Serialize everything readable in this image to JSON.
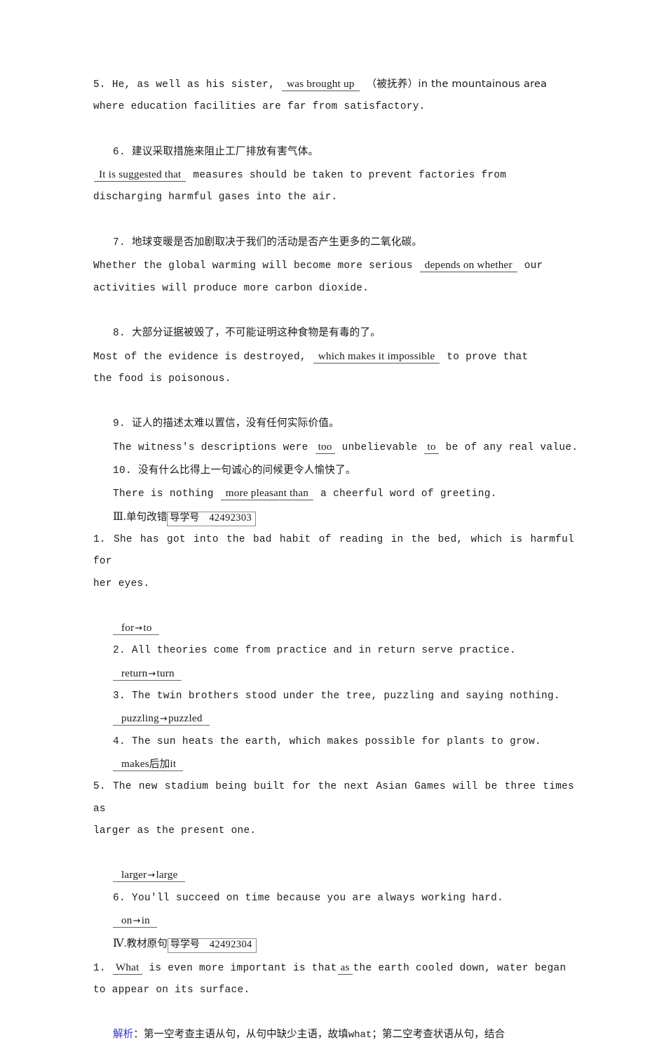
{
  "document": {
    "type": "english-grammar-workbook-page",
    "language": "zh-CN + en"
  },
  "exercises_section_2": {
    "items": [
      {
        "number": "5.",
        "pre": "He, as well as his sister,",
        "blank": "was brought up",
        "mid": "（被抚养）in the mountainous area",
        "cont": "where education facilities are far from satisfactory."
      },
      {
        "number": "6.",
        "prompt_cn": "建议采取措施来阻止工厂排放有害气体。",
        "blank": "It is suggested that",
        "post": "measures should be taken to prevent factories from",
        "cont": "discharging harmful gases into the air."
      },
      {
        "number": "7.",
        "prompt_cn": "地球变暖是否加剧取决于我们的活动是否产生更多的二氧化碳。",
        "pre": "Whether the global warming will become more serious",
        "blank": "depends on whether",
        "post": "our",
        "cont": "activities will produce more carbon dioxide."
      },
      {
        "number": "8.",
        "prompt_cn": "大部分证据被毁了，不可能证明这种食物是有毒的了。",
        "pre": "Most of the evidence is destroyed,",
        "blank": "which makes it impossible",
        "post": "to prove that",
        "cont": "the food is poisonous."
      },
      {
        "number": "9.",
        "prompt_cn": "证人的描述太难以置信，没有任何实际价值。",
        "pre": "The witness's descriptions were",
        "blank1": "too",
        "mid": "unbelievable",
        "blank2": "to",
        "post": "be of any real value."
      },
      {
        "number": "10.",
        "prompt_cn": "没有什么比得上一句诚心的问候更令人愉快了。",
        "pre": "There is nothing",
        "blank": "more pleasant than",
        "post": "a cheerful word of greeting."
      }
    ]
  },
  "section_3": {
    "roman": "Ⅲ.",
    "title_cn": "单句改错",
    "badge_label": "导学号",
    "badge_number": "42492303",
    "items": [
      {
        "number": "1.",
        "sentence_line1": "She has got into the bad habit of reading in the bed, which is harmful for",
        "sentence_line2": "her eyes.",
        "answer_from": "for",
        "answer_to": "to"
      },
      {
        "number": "2.",
        "sentence_line1": "All theories come from practice and in return serve practice.",
        "answer_from": "return",
        "answer_to": "turn"
      },
      {
        "number": "3.",
        "sentence_line1": "The twin brothers stood under the tree, puzzling and saying nothing.",
        "answer_from": "puzzling",
        "answer_to": "puzzled"
      },
      {
        "number": "4.",
        "sentence_line1": "The sun heats the earth, which makes possible for plants to grow.",
        "answer_raw": "makes 后加 it",
        "answer_en1": "makes",
        "answer_cn": "后加",
        "answer_en2": "it"
      },
      {
        "number": "5.",
        "sentence_line1": "The new stadium being built for the next Asian Games will be three times as",
        "sentence_line2": "larger as the present one.",
        "answer_from": "larger",
        "answer_to": "large"
      },
      {
        "number": "6.",
        "sentence_line1": "You'll succeed on time because you are always working hard.",
        "answer_from": "on",
        "answer_to": "in"
      }
    ]
  },
  "section_4": {
    "roman": "Ⅳ.",
    "title_cn": "教材原句",
    "badge_label": "导学号",
    "badge_number": "42492304",
    "items": [
      {
        "number": "1.",
        "blank1": "What",
        "mid1": "is even more important is that",
        "blank2": "as",
        "mid2": "the earth cooled down, water began",
        "cont": "to appear on its surface.",
        "analysis_tag": "解析",
        "analysis_sep": "：",
        "analysis_text_part1": "第一空考查主语从句，从句中缺少主语，故填",
        "analysis_en": "what",
        "analysis_text_part2": "；第二空考查状语从句，结合"
      }
    ]
  },
  "colors": {
    "text": "#1a1a1a",
    "analysis_tag": "#3333cc",
    "badge_border": "#8c8c8c",
    "blank_underline": "#555555",
    "page_background": "#ffffff"
  }
}
